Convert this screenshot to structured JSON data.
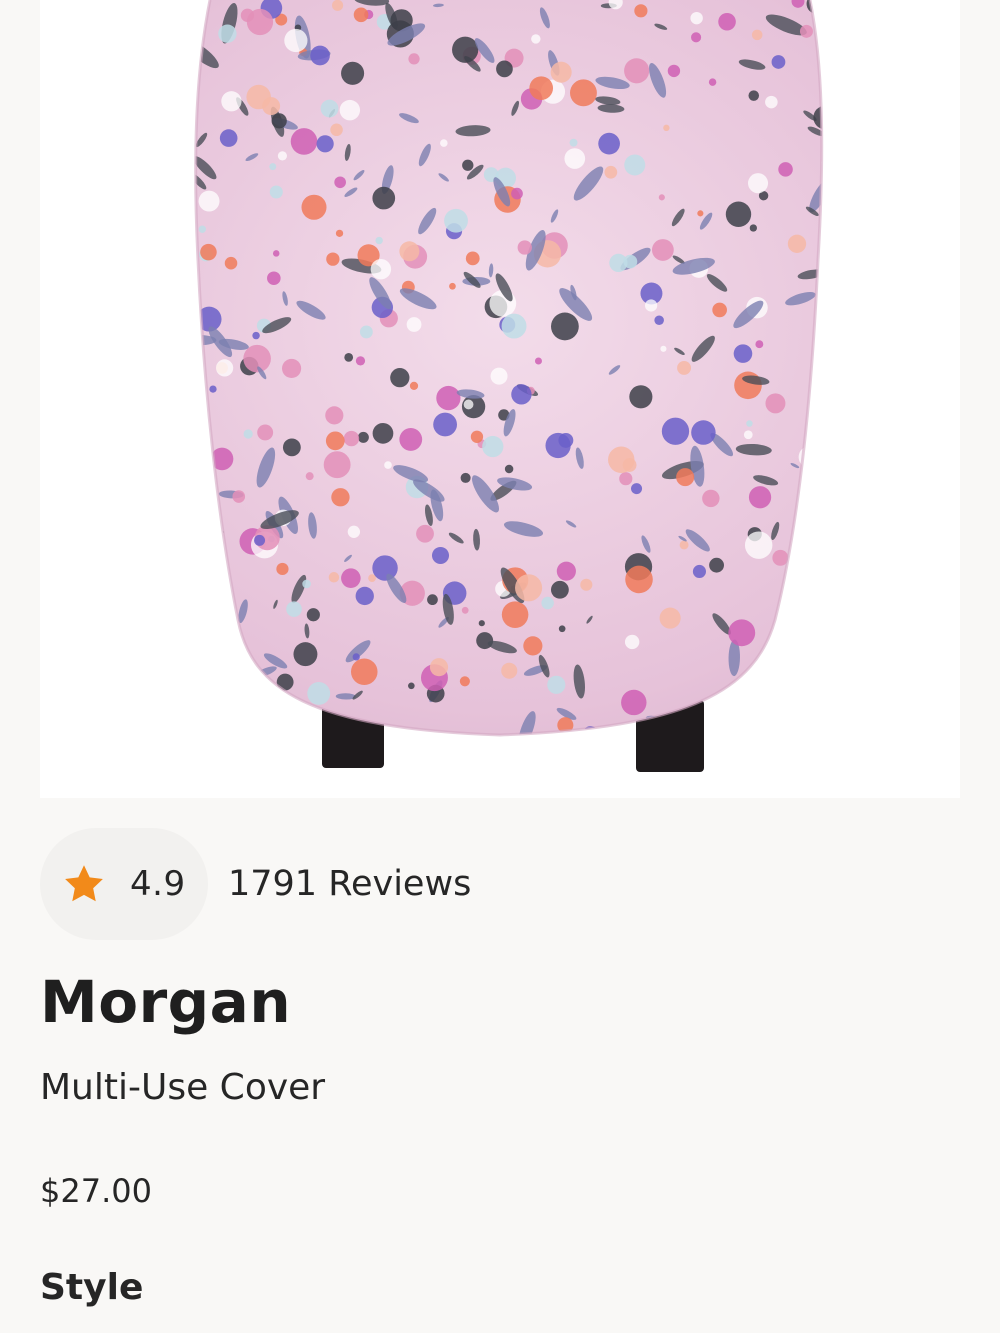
{
  "product": {
    "image_alt": "Floral pink multi-use cover on car seat",
    "rating": "4.9",
    "reviews_text": "1791 Reviews",
    "name": "Morgan",
    "subtitle": "Multi-Use Cover",
    "price": "$27.00",
    "style_label": "Style"
  },
  "icons": {
    "rating_star": "star-icon"
  },
  "colors": {
    "star": "#f28a1a",
    "page_background": "#f9f8f6",
    "pill_background": "#f2f1ef",
    "fabric_pink": "#e8c9de"
  }
}
